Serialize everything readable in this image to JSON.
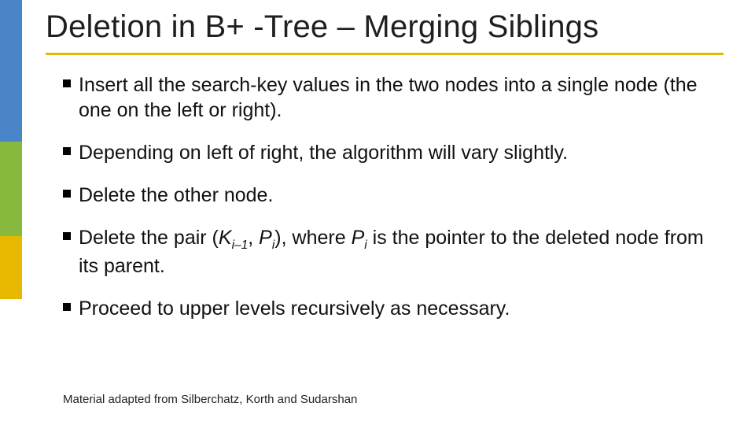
{
  "title": "Deletion in B+ -Tree – Merging Siblings",
  "bullets": {
    "b1": "Insert all the search-key values in the two nodes into a single node (the one on the left or right).",
    "b2": "Depending on left of right, the algorithm will vary slightly.",
    "b3": "Delete the other node.",
    "b4_prefix": "Delete the pair (",
    "b4_k": "K",
    "b4_ksub": "i–1",
    "b4_mid": ", ",
    "b4_p": "P",
    "b4_psub": "i",
    "b4_close": "), where ",
    "b4_p2": "P",
    "b4_p2sub": "i",
    "b4_suffix": " is the pointer to the deleted node from its parent.",
    "b5": "Proceed to upper levels recursively as necessary."
  },
  "footer": "Material adapted from Silberchatz, Korth and Sudarshan"
}
